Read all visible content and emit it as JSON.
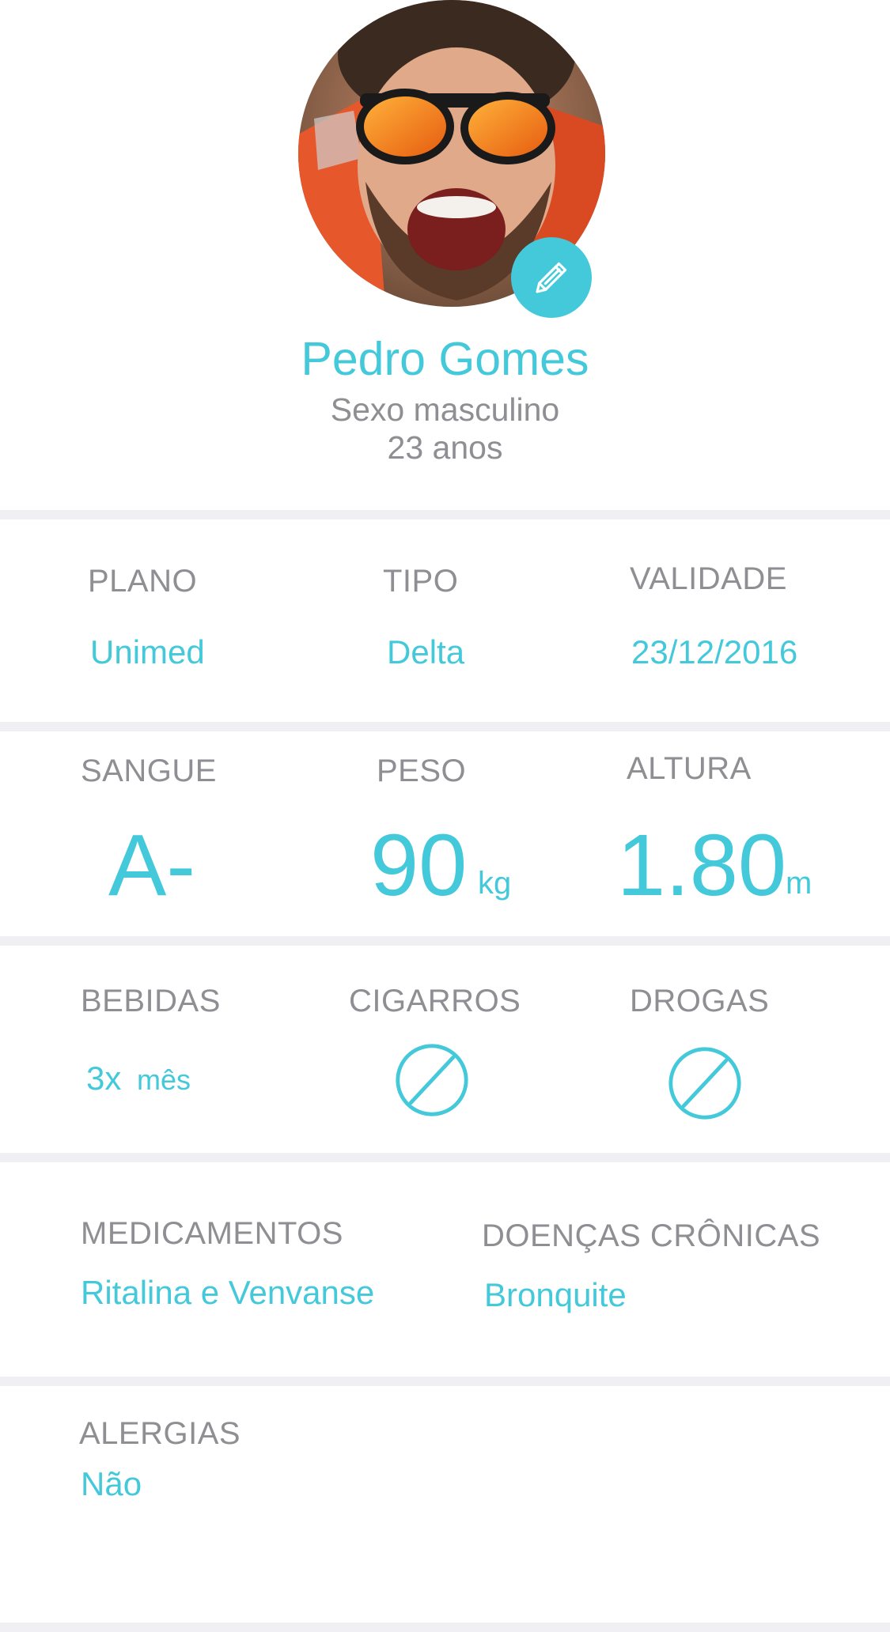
{
  "profile": {
    "name": "Pedro Gomes",
    "sex": "Sexo masculino",
    "age": "23 anos",
    "edit_icon": "pencil-icon"
  },
  "plan": {
    "plano_label": "PLANO",
    "plano_value": "Unimed",
    "tipo_label": "TIPO",
    "tipo_value": "Delta",
    "validade_label": "VALIDADE",
    "validade_value": "23/12/2016"
  },
  "metrics": {
    "sangue_label": "SANGUE",
    "sangue_value": "A-",
    "peso_label": "PESO",
    "peso_value": "90",
    "peso_unit": "kg",
    "altura_label": "ALTURA",
    "altura_value": "1.80",
    "altura_unit": "m"
  },
  "habits": {
    "bebidas_label": "BEBIDAS",
    "bebidas_value": "3x",
    "bebidas_unit": "mês",
    "cigarros_label": "CIGARROS",
    "cigarros_icon": "prohibited-icon",
    "drogas_label": "DROGAS",
    "drogas_icon": "prohibited-icon"
  },
  "health": {
    "medicamentos_label": "MEDICAMENTOS",
    "medicamentos_value": "Ritalina e Venvanse",
    "doencas_label": "DOENÇAS CRÔNICAS",
    "doencas_value": "Bronquite"
  },
  "allergies": {
    "label": "ALERGIAS",
    "value": "Não"
  },
  "colors": {
    "accent": "#43c9da",
    "label_gray": "#8e8e93",
    "divider": "#efeff4",
    "background": "#ffffff"
  }
}
